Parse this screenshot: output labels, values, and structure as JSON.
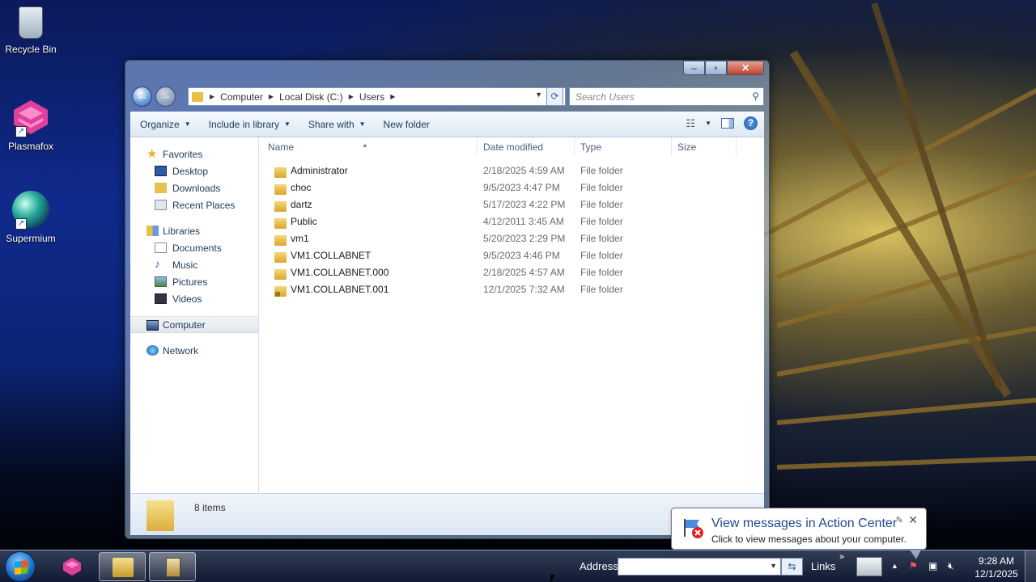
{
  "desktop": {
    "icons": [
      {
        "label": "Recycle Bin"
      },
      {
        "label": "Plasmafox"
      },
      {
        "label": "Supermium"
      }
    ]
  },
  "window": {
    "address": {
      "crumbs": [
        "Computer",
        "Local Disk (C:)",
        "Users"
      ]
    },
    "search_placeholder": "Search Users",
    "toolbar": {
      "organize": "Organize",
      "include": "Include in library",
      "share": "Share with",
      "new_folder": "New folder"
    },
    "nav": {
      "favorites": "Favorites",
      "desktop": "Desktop",
      "downloads": "Downloads",
      "recent": "Recent Places",
      "libraries": "Libraries",
      "documents": "Documents",
      "music": "Music",
      "pictures": "Pictures",
      "videos": "Videos",
      "computer": "Computer",
      "network": "Network"
    },
    "columns": {
      "name": "Name",
      "date": "Date modified",
      "type": "Type",
      "size": "Size"
    },
    "files": [
      {
        "name": "Administrator",
        "date": "2/18/2025 4:59 AM",
        "type": "File folder"
      },
      {
        "name": "choc",
        "date": "9/5/2023 4:47 PM",
        "type": "File folder"
      },
      {
        "name": "dartz",
        "date": "5/17/2023 4:22 PM",
        "type": "File folder"
      },
      {
        "name": "Public",
        "date": "4/12/2011 3:45 AM",
        "type": "File folder"
      },
      {
        "name": "vm1",
        "date": "5/20/2023 2:29 PM",
        "type": "File folder"
      },
      {
        "name": "VM1.COLLABNET",
        "date": "9/5/2023 4:46 PM",
        "type": "File folder"
      },
      {
        "name": "VM1.COLLABNET.000",
        "date": "2/18/2025 4:57 AM",
        "type": "File folder"
      },
      {
        "name": "VM1.COLLABNET.001",
        "date": "12/1/2025 7:32 AM",
        "type": "File folder"
      }
    ],
    "status": "8 items"
  },
  "balloon": {
    "title": "View messages in Action Center",
    "subtitle": "Click to view messages about your computer."
  },
  "taskbar": {
    "address_label": "Address",
    "links_label": "Links",
    "time": "9:28 AM",
    "date": "12/1/2025"
  }
}
